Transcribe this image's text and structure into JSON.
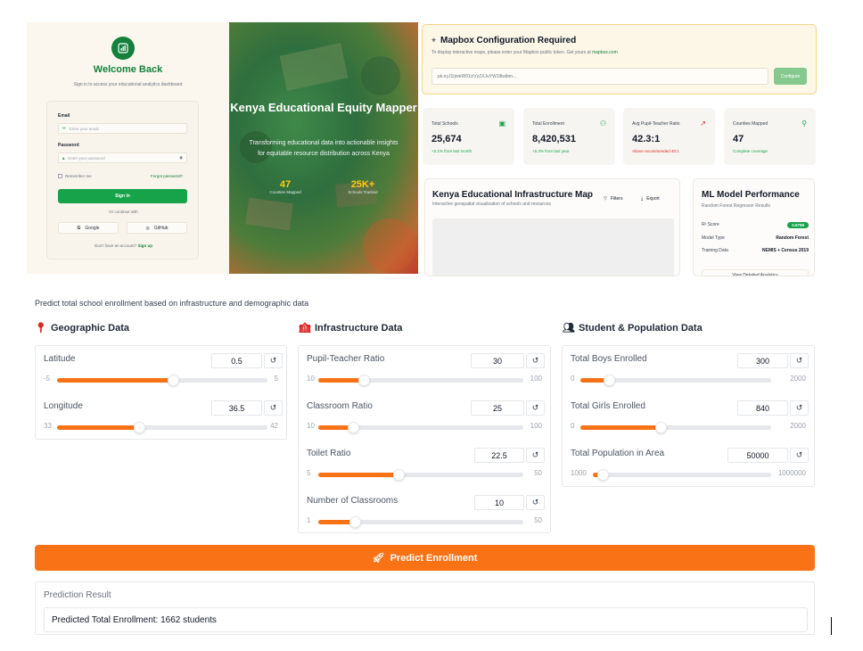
{
  "login": {
    "welcome": "Welcome Back",
    "subtitle": "Sign in to access your educational analytics dashboard",
    "email_label": "Email",
    "email_placeholder": "Enter your email",
    "password_label": "Password",
    "password_placeholder": "Enter your password",
    "remember": "Remember me",
    "forgot": "Forgot password?",
    "signin": "Sign In",
    "continue_with": "Or continue with",
    "google": "Google",
    "github": "GitHub",
    "no_account": "Don't have an account?",
    "signup": "Sign up"
  },
  "hero": {
    "title": "Kenya Educational Equity Mapper",
    "description": "Transforming educational data into actionable insights for equitable resource distribution across Kenya",
    "stat1_value": "47",
    "stat1_label": "Counties Mapped",
    "stat2_value": "25K+",
    "stat2_label": "Schools Tracked"
  },
  "mapbox": {
    "title": "Mapbox Configuration Required",
    "subtitle": "To display interactive maps, please enter your Mapbox public token. Get yours at",
    "link": "mapbox.com",
    "token_value": "pk.eyJ1IjoieW91ciVzZXJuYW1lIiwibm...",
    "configure": "Configure"
  },
  "stats": [
    {
      "label": "Total Schools",
      "value": "25,674",
      "sub": "+2.1% from last month",
      "sub_color": "#16a34a",
      "icon": "school-icon"
    },
    {
      "label": "Total Enrollment",
      "value": "8,420,531",
      "sub": "+5.3% from last year",
      "sub_color": "#16a34a",
      "icon": "users-icon"
    },
    {
      "label": "Avg Pupil-Teacher Ratio",
      "value": "42.3:1",
      "sub": "Above recommended 40:1",
      "sub_color": "#dc2626",
      "icon": "trend-up-icon"
    },
    {
      "label": "Counties Mapped",
      "value": "47",
      "sub": "Complete coverage",
      "sub_color": "#16a34a",
      "icon": "map-pin-icon"
    }
  ],
  "map_card": {
    "title": "Kenya Educational Infrastructure Map",
    "subtitle": "Interactive geospatial visualization of schools and resources",
    "filters": "Filters",
    "export": "Export"
  },
  "ml_card": {
    "title": "ML Model Performance",
    "subtitle": "Random Forest Regressor Results",
    "r2_label": "R² Score",
    "r2_value": "0.9799",
    "model_type_label": "Model Type",
    "model_type_value": "Random Forest",
    "training_label": "Training Data",
    "training_value": "NEMIS + Census 2019",
    "detail": "View Detailed Analytics"
  },
  "form": {
    "description": "Predict total school enrollment based on infrastructure and demographic data",
    "sections": {
      "geo": "Geographic Data",
      "infra": "Infrastructure Data",
      "pop": "Student & Population Data"
    },
    "geo": [
      {
        "label": "Latitude",
        "value": "0.5",
        "min": "-5",
        "max": "5",
        "frac": 0.55
      },
      {
        "label": "Longitude",
        "value": "36.5",
        "min": "33",
        "max": "42",
        "frac": 0.39
      }
    ],
    "infra": [
      {
        "label": "Pupil-Teacher Ratio",
        "value": "30",
        "min": "10",
        "max": "100",
        "frac": 0.22
      },
      {
        "label": "Classroom Ratio",
        "value": "25",
        "min": "10",
        "max": "100",
        "frac": 0.17
      },
      {
        "label": "Toilet Ratio",
        "value": "22.5",
        "min": "5",
        "max": "50",
        "frac": 0.39
      },
      {
        "label": "Number of Classrooms",
        "value": "10",
        "min": "1",
        "max": "50",
        "frac": 0.18
      }
    ],
    "pop": [
      {
        "label": "Total Boys Enrolled",
        "value": "300",
        "min": "0",
        "max": "2000",
        "frac": 0.15
      },
      {
        "label": "Total Girls Enrolled",
        "value": "840",
        "min": "0",
        "max": "2000",
        "frac": 0.42
      },
      {
        "label": "Total Population in Area",
        "value": "50000",
        "min": "1000",
        "max": "1000000",
        "frac": 0.05
      }
    ],
    "predict_button": "Predict Enrollment",
    "result_label": "Prediction Result",
    "result_value": "Predicted Total Enrollment: 1662 students"
  },
  "colors": {
    "accent": "#f97316",
    "brand_green": "#15803d"
  }
}
